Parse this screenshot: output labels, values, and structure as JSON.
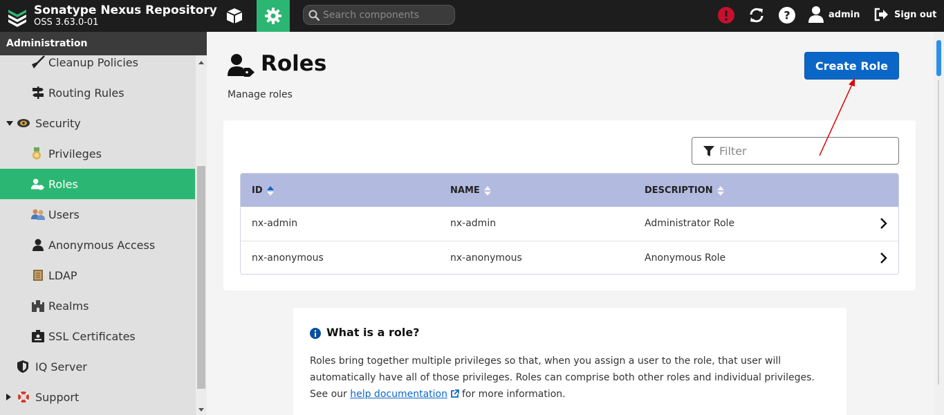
{
  "app": {
    "title": "Sonatype Nexus Repository",
    "version": "OSS 3.63.0-01"
  },
  "topbar": {
    "search_placeholder": "Search components",
    "user": "admin",
    "signout": "Sign out",
    "colors": {
      "bar": "#1d1d1d",
      "accent": "#2cb673",
      "alert": "#c8102e"
    }
  },
  "sidebar": {
    "header": "Administration",
    "items": [
      {
        "label": "Cleanup Policies",
        "icon": "broom-icon"
      },
      {
        "label": "Routing Rules",
        "icon": "signpost-icon"
      },
      {
        "label": "Security",
        "icon": "security-badge-icon",
        "expanded": true
      },
      {
        "label": "Privileges",
        "icon": "medal-icon"
      },
      {
        "label": "Roles",
        "icon": "user-tag-icon",
        "active": true
      },
      {
        "label": "Users",
        "icon": "users-icon"
      },
      {
        "label": "Anonymous Access",
        "icon": "user-icon"
      },
      {
        "label": "LDAP",
        "icon": "book-icon"
      },
      {
        "label": "Realms",
        "icon": "castle-icon"
      },
      {
        "label": "SSL Certificates",
        "icon": "id-badge-icon"
      },
      {
        "label": "IQ Server",
        "icon": "shield-icon"
      },
      {
        "label": "Support",
        "icon": "lifebuoy-icon",
        "expanded": false
      }
    ]
  },
  "main": {
    "title": "Roles",
    "subtitle": "Manage roles",
    "create_button": "Create Role",
    "filter_placeholder": "Filter",
    "table": {
      "columns": [
        "ID",
        "NAME",
        "DESCRIPTION"
      ],
      "rows": [
        {
          "id": "nx-admin",
          "name": "nx-admin",
          "description": "Administrator Role"
        },
        {
          "id": "nx-anonymous",
          "name": "nx-anonymous",
          "description": "Anonymous Role"
        }
      ]
    },
    "info": {
      "title": "What is a role?",
      "text_before_link": "Roles bring together multiple privileges so that, when you assign a user to the role, that user will automatically have all of those privileges. Roles can comprise both other roles and individual privileges. See our",
      "link": "help documentation",
      "text_after_link": "for more information."
    }
  }
}
